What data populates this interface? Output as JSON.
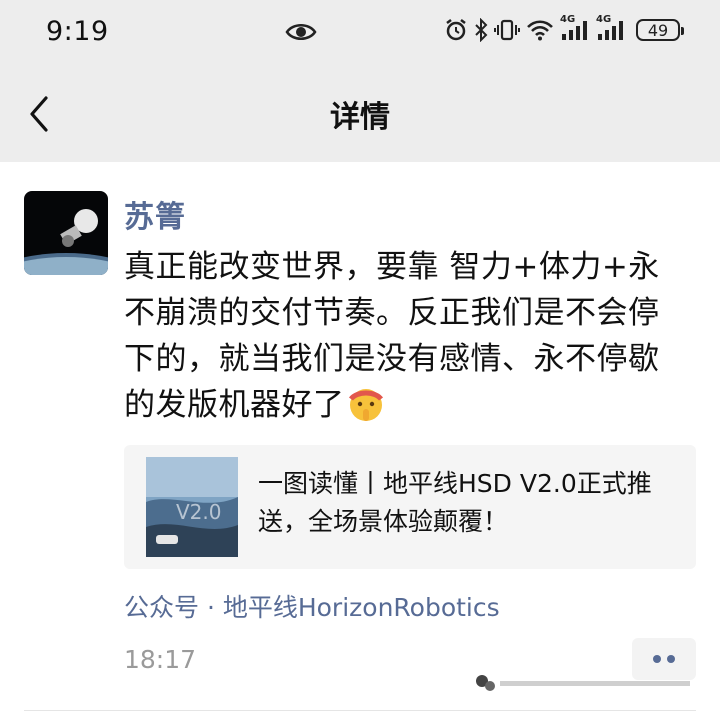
{
  "status_bar": {
    "time": "9:19",
    "network_label_1": "4G",
    "network_label_2": "4G",
    "battery": "49"
  },
  "header": {
    "title": "详情"
  },
  "post": {
    "author": "苏箐",
    "text": "真正能改变世界，要靠 智力+体力+永不崩溃的交付节奏。反正我们是不会停下的，就当我们是没有感情、永不停歇的发版机器好了",
    "emoji": "shushing-face-with-headband",
    "link_card": {
      "title": "一图读懂丨地平线HSD V2.0正式推送，全场景体验颠覆！",
      "thumbnail_text": "V2.0"
    },
    "source": "公众号 · 地平线HorizonRobotics",
    "time": "18:17"
  },
  "colors": {
    "top_bar": "#ededed",
    "name_link": "#576b95",
    "time_gray": "#9a9a9a",
    "card_bg": "#f5f5f5"
  }
}
